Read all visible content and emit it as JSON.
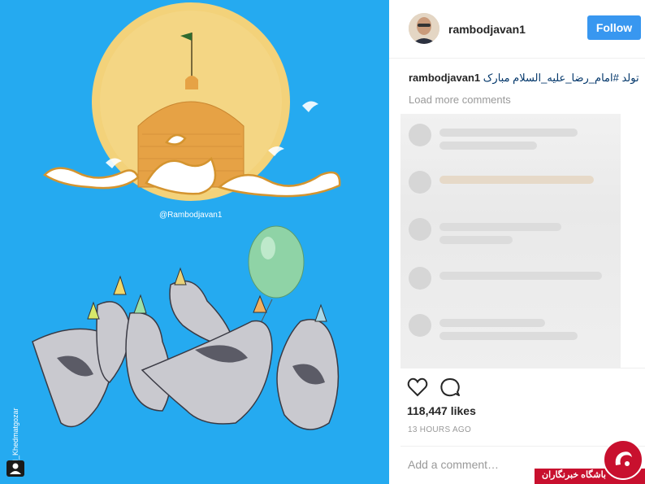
{
  "post": {
    "username": "rambodjavan1",
    "follow_label": "Follow",
    "caption_user": "rambodjavan1",
    "caption_text": "تولد #امام_رضا_علیه_السلام مبارک",
    "load_more": "Load more comments",
    "likes": "118,447 likes",
    "time": "13 HOURS AGO",
    "comment_placeholder": "Add a comment…"
  },
  "image": {
    "watermark": "@Rambodjavan1",
    "artist_signature": "d_Khedmatgozar",
    "colors": {
      "background": "#25aaf0",
      "sun": "#f3d27a",
      "dome": "#e9a94a"
    }
  },
  "badge": {
    "text": "باشگاه خبرنگاران"
  },
  "icons": {
    "like": "heart-icon",
    "comment": "comment-icon",
    "tag": "user-tag-icon"
  }
}
